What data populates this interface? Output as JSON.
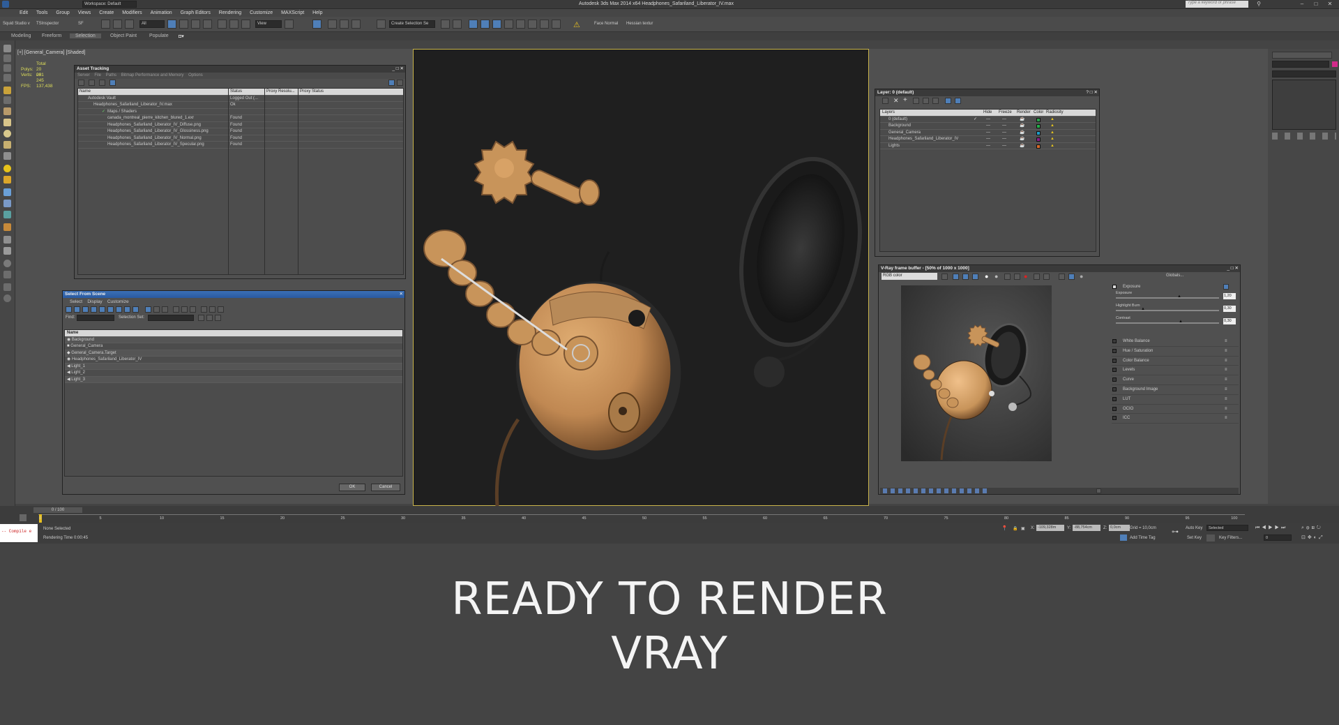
{
  "app": {
    "title": "Autodesk 3ds Max  2014 x64    Headphones_Safariland_Liberator_IV.max",
    "search_placeholder": "Type a keyword or phrase",
    "workspace": "Workspace: Default"
  },
  "menu": [
    "Edit",
    "Tools",
    "Group",
    "Views",
    "Create",
    "Modifiers",
    "Animation",
    "Graph Editors",
    "Rendering",
    "Customize",
    "MAXScript",
    "Help"
  ],
  "toolbar": {
    "left_label_1": "Squid Studio v",
    "left_label_2": "TSInspector",
    "left_label_3": "SF",
    "filter_dropdown": "All",
    "view_dropdown": "View",
    "selection_set": "Create Selection Se",
    "face_normal": "Face Normal",
    "hessian": "Hessian textur"
  },
  "ribbon": {
    "tabs": [
      "Modeling",
      "Freeform",
      "Selection",
      "Object Paint",
      "Populate"
    ],
    "active": "Selection"
  },
  "viewport": {
    "label": "[+] [General_Camera] [Shaded]",
    "stats": {
      "total_label": "Total",
      "polys_label": "Polys:",
      "polys": "20 081",
      "verts_label": "Verts:",
      "verts": "20 245",
      "fps_label": "FPS:",
      "fps": "137,438"
    }
  },
  "asset_tracking": {
    "title": "Asset Tracking",
    "menu": [
      "Server",
      "File",
      "Paths",
      "Bitmap Performance and Memory",
      "Options"
    ],
    "columns": [
      "Name",
      "Status",
      "Proxy Resolu...",
      "Proxy Status"
    ],
    "rows": [
      {
        "name": "Autodesk Vault",
        "status": "Logged Out (..."
      },
      {
        "name": "Headphones_Safariland_Liberator_IV.max",
        "status": "Ok"
      },
      {
        "name": "Maps / Shaders",
        "status": ""
      },
      {
        "name": "canada_montreal_pierre_kitchen_blured_1.exr",
        "status": "Found"
      },
      {
        "name": "Headphones_Safariland_Liberator_IV_Diffuse.png",
        "status": "Found"
      },
      {
        "name": "Headphones_Safariland_Liberator_IV_Glossiness.png",
        "status": "Found"
      },
      {
        "name": "Headphones_Safariland_Liberator_IV_Normal.png",
        "status": "Found"
      },
      {
        "name": "Headphones_Safariland_Liberator_IV_Specular.png",
        "status": "Found"
      }
    ]
  },
  "select_from_scene": {
    "title": "Select From Scene",
    "menu": [
      "Select",
      "Display",
      "Customize"
    ],
    "find_label": "Find:",
    "selection_set_label": "Selection Set:",
    "column": "Name",
    "items": [
      "Background",
      "General_Camera",
      "General_Camera.Target",
      "Headphones_Safariland_Liberator_IV",
      "Light_1",
      "Light_2",
      "Light_3"
    ],
    "ok": "OK",
    "cancel": "Cancel"
  },
  "layer_manager": {
    "title": "Layer: 0 (default)",
    "columns": [
      "Layers",
      "Hide",
      "Freeze",
      "Render",
      "Color",
      "Radiosity"
    ],
    "layers": [
      {
        "name": "0 (default)",
        "color": "#2aa04a"
      },
      {
        "name": "Background",
        "color": "#23b04a"
      },
      {
        "name": "General_Camera",
        "color": "#1e9ec8"
      },
      {
        "name": "Headphones_Safariland_Liberator_IV",
        "color": "#8a1e8a"
      },
      {
        "name": "Lights",
        "color": "#d86a2a"
      }
    ]
  },
  "vray_fb": {
    "title": "V-Ray frame buffer - [50% of 1000 x 1000]",
    "channel": "RGB color",
    "globals": "Globals...",
    "exposure_label": "Exposure",
    "exposure_params": [
      {
        "label": "Exposure",
        "value": "1,20"
      },
      {
        "label": "Highlight Burn",
        "value": "0,30"
      },
      {
        "label": "Contrast",
        "value": "0,30"
      }
    ],
    "corrections": [
      "White Balance",
      "Hue / Saturation",
      "Color Balance",
      "Levels",
      "Curve",
      "Background Image",
      "LUT",
      "OCIO",
      "ICC"
    ]
  },
  "timeline": {
    "frame": "0 / 100",
    "ticks": [
      "0",
      "5",
      "10",
      "15",
      "20",
      "25",
      "30",
      "35",
      "40",
      "45",
      "50",
      "55",
      "60",
      "65",
      "70",
      "75",
      "80",
      "85",
      "90",
      "95",
      "100"
    ]
  },
  "status": {
    "maxscript": "-- Compile e",
    "selection": "None Selected",
    "render_time": "Rendering Time  0:00:45",
    "x_label": "X:",
    "x": "-109,328m",
    "y_label": "Y:",
    "y": "-88,754cm",
    "z_label": "Z:",
    "z": "0,0cm",
    "grid": "Grid = 10,0cm",
    "auto_key": "Auto Key",
    "selected": "Selected",
    "set_key": "Set Key",
    "key_filters": "Key Filters...",
    "add_time_tag": "Add Time Tag",
    "frame_field": "0"
  },
  "caption": {
    "line1": "READY TO RENDER",
    "line2": "VRAY"
  },
  "colors": {
    "accent_blue": "#3b6fb6",
    "viewport_border": "#c9b44a",
    "object_tan": "#c8945a"
  }
}
